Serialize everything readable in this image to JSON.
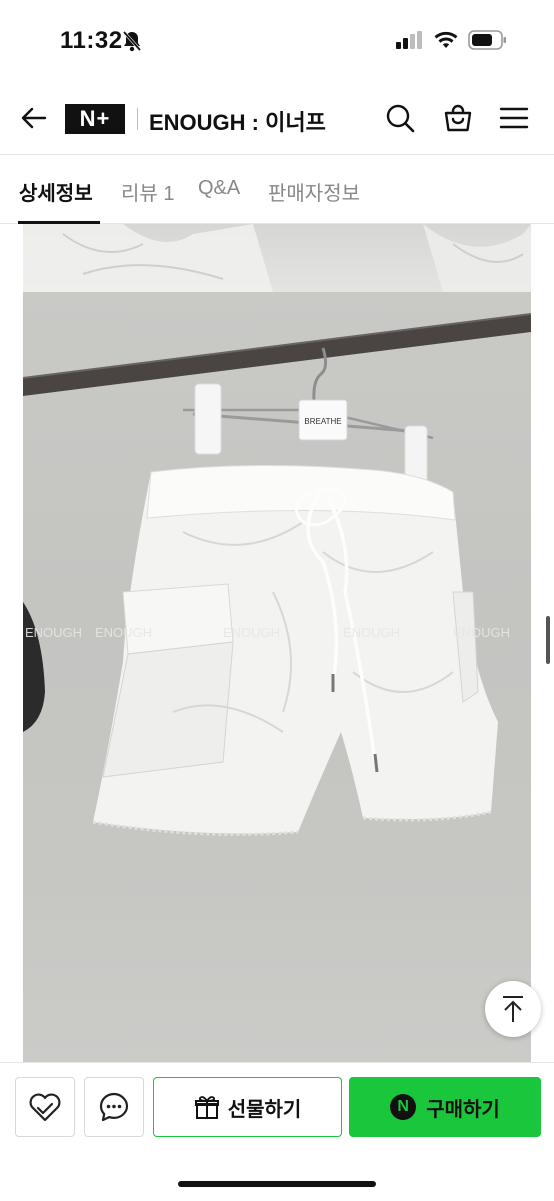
{
  "status_bar": {
    "time": "11:32"
  },
  "header": {
    "logo_text": "N+",
    "store_name": "ENOUGH : 이너프",
    "icons": [
      "back-arrow-icon",
      "search-icon",
      "shopping-bag-icon",
      "menu-icon"
    ]
  },
  "tabs": [
    {
      "label": "상세정보",
      "active": true
    },
    {
      "label": "리뷰 1",
      "active": false
    },
    {
      "label": "Q&A",
      "active": false
    },
    {
      "label": "판매자정보",
      "active": false
    }
  ],
  "product_image": {
    "hanger_tag": "BREATHE",
    "watermark": "ENOUGH"
  },
  "bottom_bar": {
    "gift_label": "선물하기",
    "buy_label": "구매하기",
    "buy_badge": "N"
  },
  "colors": {
    "accent_green": "#19c63c",
    "text_dark": "#111111",
    "tab_inactive": "#888888"
  }
}
